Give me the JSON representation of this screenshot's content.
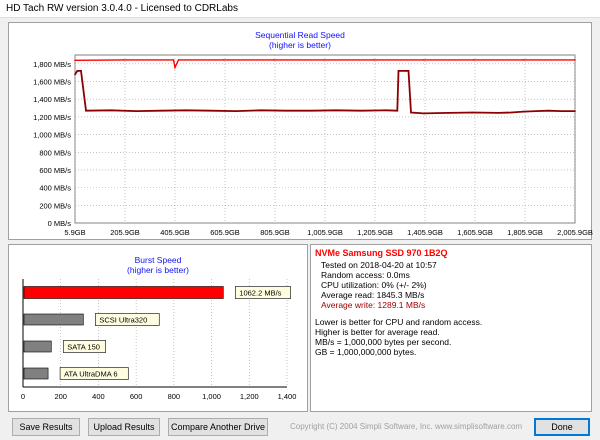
{
  "window": {
    "title": "HD Tach RW version 3.0.4.0 - Licensed to CDRLabs"
  },
  "sequential": {
    "title": "Sequential Read Speed",
    "subtitle": "(higher is better)"
  },
  "burst": {
    "title": "Burst Speed",
    "subtitle": "(higher is better)"
  },
  "info": {
    "drive_name": "NVMe Samsung SSD 970 1B2Q",
    "tested_on": "Tested on 2018-04-20 at 10:57",
    "random_access": "Random access: 0.0ms",
    "cpu": "CPU utilization: 0% (+/- 2%)",
    "avg_read": "Average read: 1845.3 MB/s",
    "avg_write": "Average write: 1289.1 MB/s",
    "note1": "Lower is better for CPU and random access.",
    "note2": "Higher is better for average read.",
    "note3": "MB/s = 1,000,000 bytes per second.",
    "note4": "GB = 1,000,000,000 bytes.",
    "write_color": "#a00000",
    "title_color": "#ff0000"
  },
  "buttons": {
    "save": "Save Results",
    "upload": "Upload Results",
    "compare": "Compare Another Drive",
    "done": "Done"
  },
  "copyright": "Copyright (C) 2004 Simpli Software, Inc. www.simplisoftware.com",
  "chart_data": [
    {
      "type": "line",
      "title": "Sequential Read Speed",
      "subtitle": "(higher is better)",
      "y_ticks": [
        "0 MB/s",
        "200 MB/s",
        "400 MB/s",
        "600 MB/s",
        "800 MB/s",
        "1,000 MB/s",
        "1,200 MB/s",
        "1,400 MB/s",
        "1,600 MB/s",
        "1,800 MB/s"
      ],
      "x_ticks": [
        "5.9GB",
        "205.9GB",
        "405.9GB",
        "605.9GB",
        "805.9GB",
        "1,005.9GB",
        "1,205.9GB",
        "1,405.9GB",
        "1,605.9GB",
        "1,805.9GB",
        "2,005.9GB"
      ],
      "ylim": [
        0,
        1900
      ],
      "xlim": [
        5.9,
        2005.9
      ],
      "grid": true,
      "series": [
        {
          "color": "#ff0000",
          "x": [
            5.9,
            200,
            400,
            405.9,
            420,
            600,
            800,
            1000,
            1200,
            1400,
            1600,
            1800,
            2005.9
          ],
          "values": [
            1840,
            1845,
            1845,
            1760,
            1845,
            1845,
            1845,
            1845,
            1845,
            1845,
            1845,
            1845,
            1845
          ]
        },
        {
          "color": "#8b0000",
          "x": [
            5.9,
            15,
            20,
            30,
            50,
            150,
            250,
            350,
            450,
            550,
            650,
            750,
            850,
            950,
            1050,
            1150,
            1250,
            1295,
            1300,
            1330,
            1340,
            1350,
            1400,
            1500,
            1600,
            1700,
            1750,
            1800,
            1850,
            1900,
            1950,
            2005.9
          ],
          "values": [
            1680,
            1720,
            1720,
            1720,
            1270,
            1275,
            1265,
            1270,
            1275,
            1270,
            1265,
            1275,
            1270,
            1270,
            1275,
            1270,
            1275,
            1270,
            1720,
            1720,
            1720,
            1250,
            1240,
            1245,
            1250,
            1245,
            1250,
            1260,
            1265,
            1270,
            1265,
            1265
          ]
        }
      ]
    },
    {
      "type": "bar",
      "title": "Burst Speed",
      "subtitle": "(higher is better)",
      "categories": [
        "NVMe Samsung SSD 970",
        "SCSI Ultra320",
        "SATA 150",
        "ATA UltraDMA 6"
      ],
      "bar_labels": [
        "1062.2 MB/s",
        "SCSI Ultra320",
        "SATA 150",
        "ATA UltraDMA 6"
      ],
      "values": [
        1062.2,
        320,
        150,
        133
      ],
      "colors": [
        "#ff0000",
        "#808080",
        "#808080",
        "#808080"
      ],
      "x_ticks": [
        "0",
        "200",
        "400",
        "600",
        "800",
        "1,000",
        "1,200",
        "1,400"
      ],
      "xlim": [
        0,
        1400
      ]
    }
  ]
}
